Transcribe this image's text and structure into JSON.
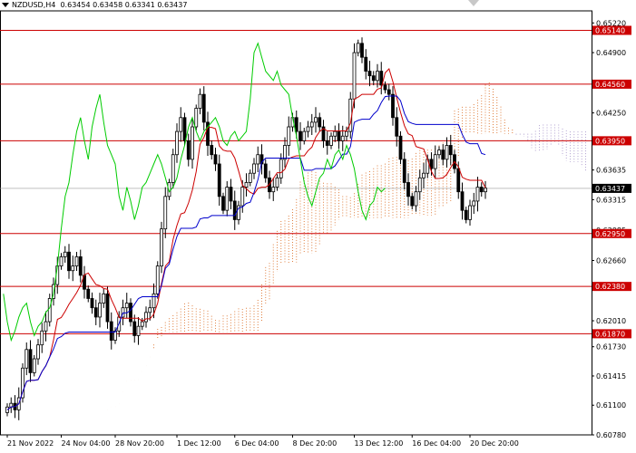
{
  "header": {
    "symbol": "NZDUSD,H4",
    "ohlc": "0.63454 0.63458 0.63341 0.63437",
    "menu_icon": "triangle-down-icon"
  },
  "colors": {
    "background": "#ffffff",
    "candle": "#000000",
    "level_line": "#cc0000",
    "level_label_bg": "#cc0000",
    "current_label_bg": "#000000",
    "tenkan": "#cc0000",
    "kijun": "#0000cc",
    "chikou": "#00cc00",
    "cloud_bull": "#e08040",
    "cloud_bear": "#b0a0d0"
  },
  "chart_data": {
    "type": "candlestick",
    "symbol": "NZDUSD",
    "timeframe": "H4",
    "ylim": [
      0.6078,
      0.6535
    ],
    "y_ticks": [
      "0.65220",
      "0.64900",
      "0.64575",
      "0.64250",
      "0.63950",
      "0.63635",
      "0.63315",
      "0.62985",
      "0.62660",
      "0.62380",
      "0.62010",
      "0.61730",
      "0.61415",
      "0.61100",
      "0.60780"
    ],
    "x_ticks": [
      {
        "label": "21 Nov 2022",
        "index": 0
      },
      {
        "label": "24 Nov 04:00",
        "index": 14
      },
      {
        "label": "28 Nov 20:00",
        "index": 28
      },
      {
        "label": "1 Dec 12:00",
        "index": 44
      },
      {
        "label": "6 Dec 04:00",
        "index": 59
      },
      {
        "label": "8 Dec 20:00",
        "index": 74
      },
      {
        "label": "13 Dec 12:00",
        "index": 90
      },
      {
        "label": "16 Dec 04:00",
        "index": 105
      },
      {
        "label": "20 Dec 20:00",
        "index": 120
      }
    ],
    "levels": [
      {
        "value": 0.6514,
        "label": "0.65140"
      },
      {
        "value": 0.6456,
        "label": "0.64560"
      },
      {
        "value": 0.6395,
        "label": "0.63950"
      },
      {
        "value": 0.6295,
        "label": "0.62950"
      },
      {
        "value": 0.6238,
        "label": "0.62380"
      },
      {
        "value": 0.6187,
        "label": "0.61870"
      }
    ],
    "current_price": {
      "value": 0.63437,
      "label": "0.63437"
    },
    "close": [
      0.6108,
      0.6112,
      0.6105,
      0.6118,
      0.615,
      0.617,
      0.6145,
      0.616,
      0.6175,
      0.619,
      0.62,
      0.6225,
      0.624,
      0.626,
      0.627,
      0.6275,
      0.6255,
      0.626,
      0.627,
      0.625,
      0.6235,
      0.6225,
      0.6215,
      0.6205,
      0.622,
      0.623,
      0.62,
      0.618,
      0.619,
      0.6205,
      0.6215,
      0.622,
      0.62,
      0.6185,
      0.6195,
      0.62,
      0.621,
      0.6215,
      0.623,
      0.626,
      0.63,
      0.6335,
      0.635,
      0.638,
      0.6405,
      0.642,
      0.6395,
      0.6375,
      0.641,
      0.643,
      0.6445,
      0.6415,
      0.639,
      0.638,
      0.637,
      0.6335,
      0.632,
      0.6345,
      0.633,
      0.631,
      0.6325,
      0.6345,
      0.635,
      0.636,
      0.637,
      0.638,
      0.637,
      0.6355,
      0.634,
      0.6345,
      0.6355,
      0.6375,
      0.639,
      0.641,
      0.642,
      0.6405,
      0.6395,
      0.6405,
      0.641,
      0.6415,
      0.642,
      0.641,
      0.6395,
      0.639,
      0.64,
      0.6405,
      0.6395,
      0.64,
      0.6405,
      0.644,
      0.649,
      0.65,
      0.6485,
      0.647,
      0.6465,
      0.646,
      0.647,
      0.6455,
      0.645,
      0.6445,
      0.642,
      0.64,
      0.6375,
      0.635,
      0.6335,
      0.6325,
      0.634,
      0.6355,
      0.636,
      0.6375,
      0.6365,
      0.638,
      0.6385,
      0.6375,
      0.639,
      0.638,
      0.6365,
      0.634,
      0.632,
      0.631,
      0.6325,
      0.633,
      0.6345,
      0.634,
      0.6344
    ]
  }
}
